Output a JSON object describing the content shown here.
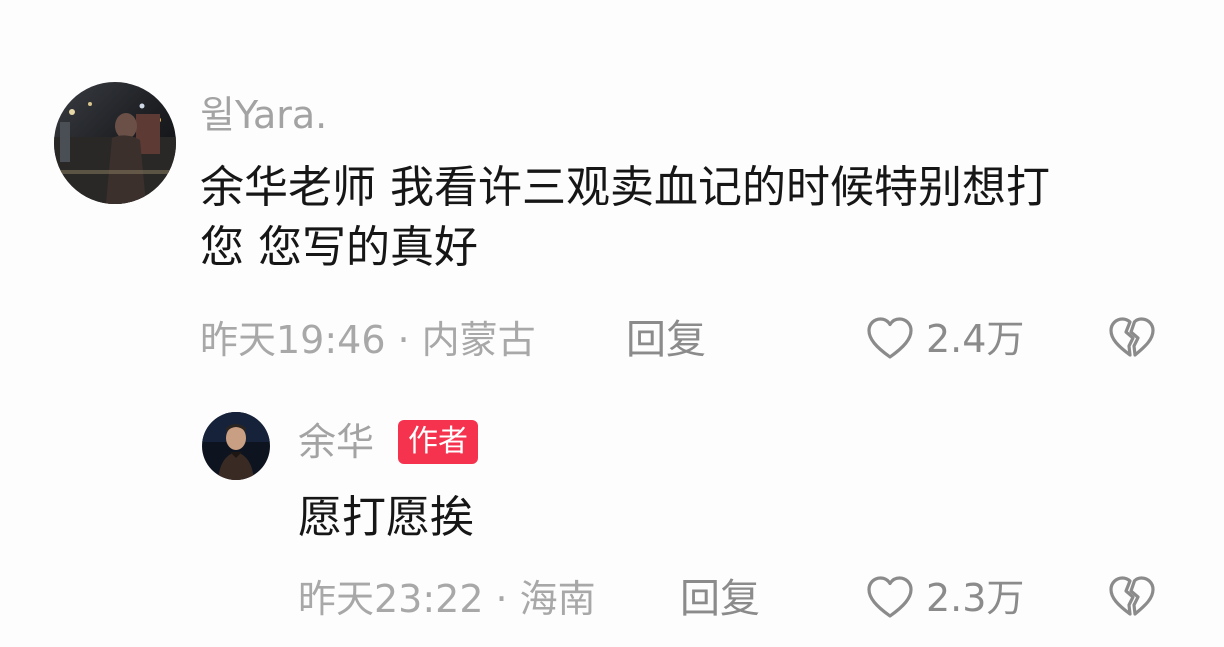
{
  "comments": [
    {
      "username": "윌Yara.",
      "text_line1": "余华老师 我看许三观卖血记的时候特别想打",
      "text_line2": "您 您写的真好",
      "time": "昨天19:46",
      "separator": "·",
      "location": "内蒙古",
      "reply_label": "回复",
      "likes": "2.4万",
      "avatar_icon": "user-photo-avatar"
    }
  ],
  "replies": [
    {
      "username": "余华",
      "badge": "作者",
      "text": "愿打愿挨",
      "time": "昨天23:22",
      "separator": "·",
      "location": "海南",
      "reply_label": "回复",
      "likes": "2.3万",
      "avatar_icon": "author-photo-avatar"
    }
  ],
  "colors": {
    "background": "#fdfdfd",
    "text_primary": "#161616",
    "text_secondary": "#a8a8a8",
    "action_gray": "#8b8b8b",
    "badge_red": "#f5334f"
  },
  "icons": {
    "like": "heart-outline-icon",
    "dislike": "broken-heart-icon"
  }
}
